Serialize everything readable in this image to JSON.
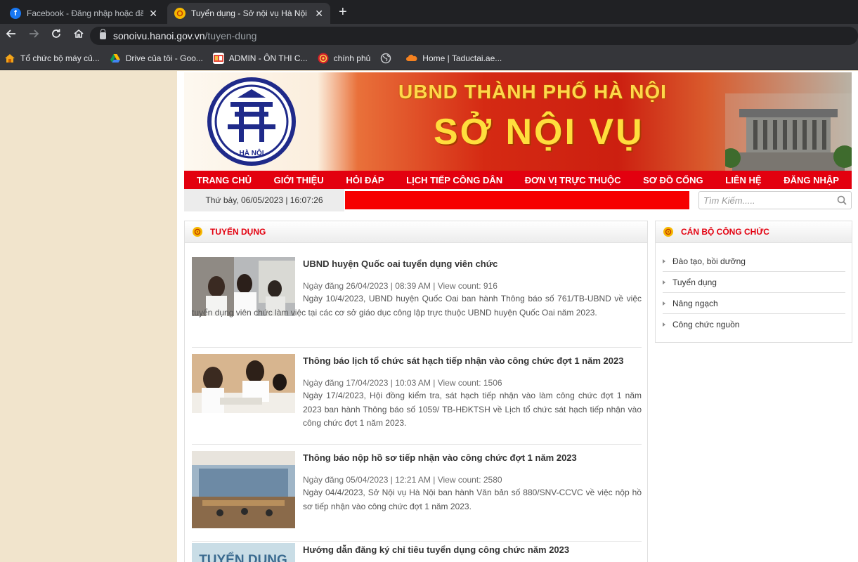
{
  "browser": {
    "tabs": [
      {
        "title": "Facebook - Đăng nhập hoặc đăng ký",
        "icon": "facebook-icon",
        "active": false
      },
      {
        "title": "Tuyển dụng - Sở nội vụ Hà Nội",
        "icon": "site-favicon",
        "active": true
      }
    ],
    "close_glyph": "✕",
    "new_tab_glyph": "+",
    "url_host": "sonoivu.hanoi.gov.vn",
    "url_path": "/tuyen-dung",
    "bookmarks": [
      {
        "label": "Tổ chức bộ máy củ...",
        "icon": "folder-icon"
      },
      {
        "label": "Drive của tôi - Goo...",
        "icon": "drive-icon"
      },
      {
        "label": "ADMIN - ÔN THI C...",
        "icon": "admin-icon"
      },
      {
        "label": "chính phủ",
        "icon": "gov-icon"
      },
      {
        "label": "",
        "icon": "globe-icon"
      },
      {
        "label": "Home | Taductai.ae...",
        "icon": "cloud-icon"
      }
    ]
  },
  "banner": {
    "line1": "UBND THÀNH PHỐ HÀ NỘI",
    "line2": "SỞ NỘI VỤ",
    "emblem_text": "HÀ NỘI"
  },
  "menu": [
    "TRANG CHỦ",
    "GIỚI THIỆU",
    "HỎI ĐÁP",
    "LỊCH TIẾP CÔNG DÂN",
    "ĐƠN VỊ TRỰC THUỘC",
    "SƠ ĐỒ CỔNG",
    "LIÊN HỆ",
    "ĐĂNG NHẬP"
  ],
  "date_text": "Thứ bảy, 06/05/2023 | 16:07:26",
  "search_placeholder": "Tìm Kiếm.....",
  "main": {
    "heading": "TUYỂN DỤNG",
    "news": [
      {
        "title": "UBND huyện Quốc oai tuyển dụng viên chức",
        "meta": "Ngày đăng 26/04/2023 | 08:39 AM  | View count: 916",
        "desc": "Ngày 10/4/2023, UBND huyện Quốc Oai ban hành Thông báo số 761/TB-UBND về việc tuyển dụng viên chức làm việc tại các cơ sở giáo dục công lập trực thuộc UBND huyện Quốc Oai năm 2023."
      },
      {
        "title": "Thông báo lịch tổ chức sát hạch tiếp nhận vào công chức đợt 1 năm 2023",
        "meta": "Ngày đăng 17/04/2023 | 10:03 AM  | View count: 1506",
        "desc": "Ngày 17/4/2023, Hội đồng kiểm tra, sát hạch tiếp nhận vào làm công chức đợt 1 năm 2023 ban hành Thông báo số 1059/ TB-HĐKTSH về Lịch tổ chức sát hạch tiếp nhận vào công chức đợt 1 năm 2023."
      },
      {
        "title": "Thông báo nộp hồ sơ tiếp nhận vào công chức đợt 1 năm 2023",
        "meta": "Ngày đăng 05/04/2023 | 12:21 AM  | View count: 2580",
        "desc": "Ngày 04/4/2023, Sở Nội vụ Hà Nội ban hành Văn bản số 880/SNV-CCVC về việc nộp hồ sơ tiếp nhận vào công chức đợt 1 năm 2023."
      },
      {
        "title": "Hướng dẫn đăng ký chỉ tiêu tuyển dụng công chức năm 2023",
        "meta": "",
        "desc": "",
        "thumb_text": "TUYỂN DỤNG"
      }
    ]
  },
  "side": {
    "heading": "CÁN BỘ CÔNG CHỨC",
    "items": [
      "Đào tạo, bồi dưỡng",
      "Tuyển dụng",
      "Nâng ngạch",
      "Công chức nguồn"
    ]
  },
  "colors": {
    "accent_red": "#e3000f",
    "banner_yellow": "#ffde3d",
    "chrome_dark": "#202124"
  }
}
